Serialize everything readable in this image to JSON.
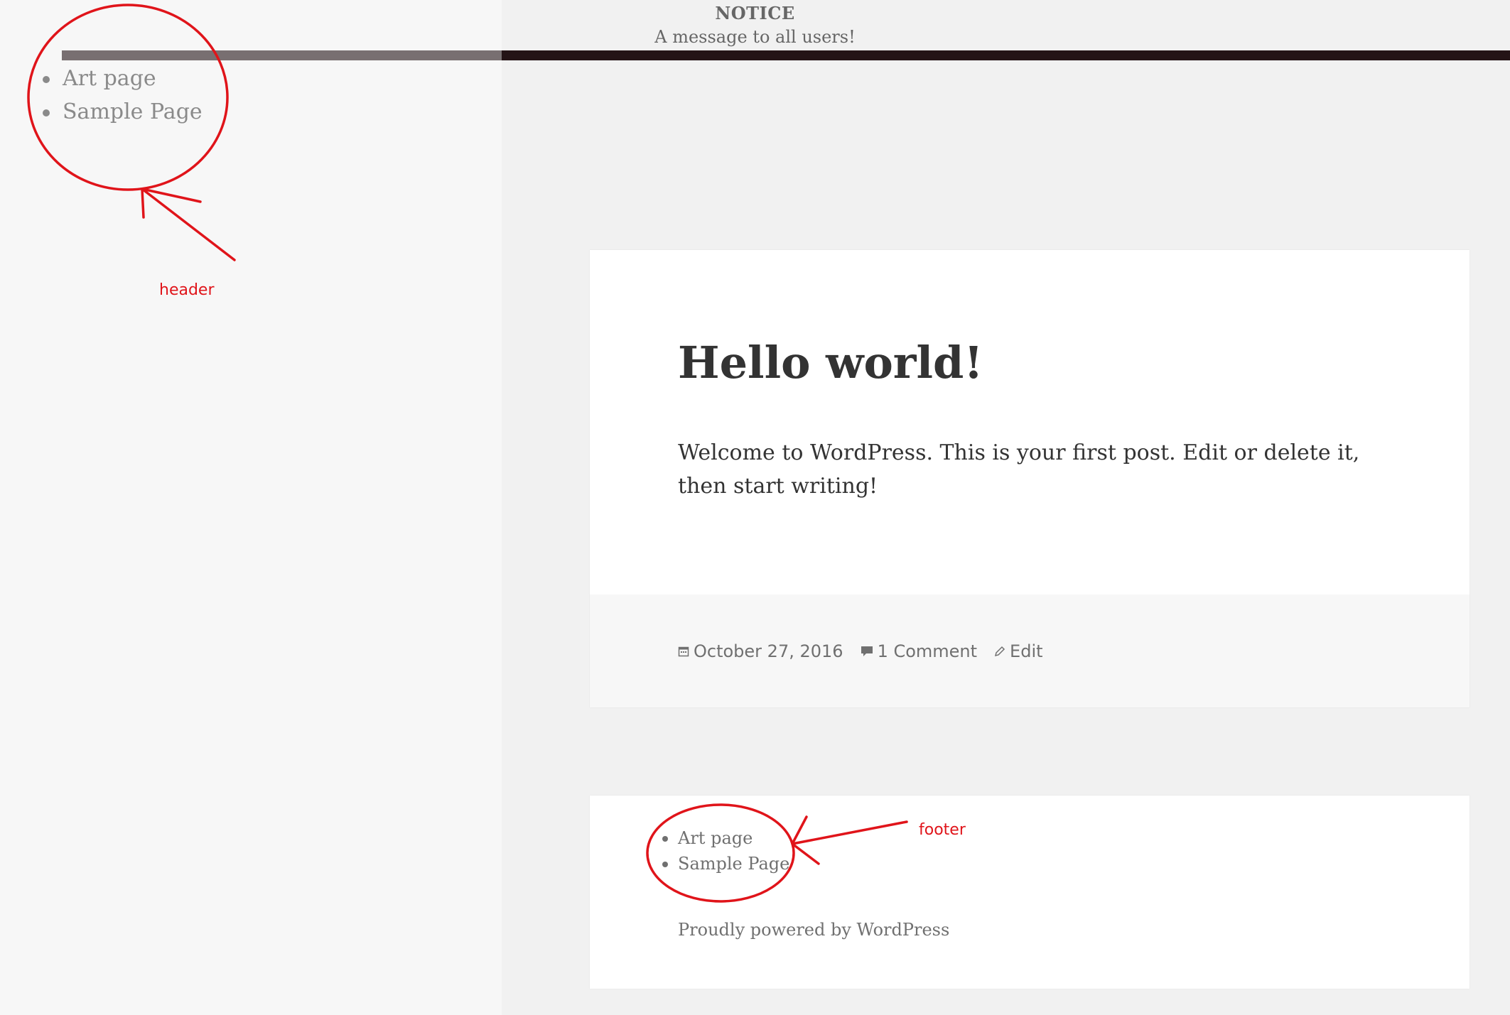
{
  "notice": {
    "title": "NOTICE",
    "message": "A message to all users!"
  },
  "header_menu": {
    "items": [
      {
        "label": "Art page"
      },
      {
        "label": "Sample Page"
      }
    ]
  },
  "post": {
    "title": "Hello world!",
    "content": "Welcome to WordPress. This is your first post. Edit or delete it, then start writing!",
    "meta": {
      "date": "October 27, 2016",
      "comments": "1 Comment",
      "edit": "Edit"
    }
  },
  "footer": {
    "menu_items": [
      {
        "label": "Art page"
      },
      {
        "label": "Sample Page"
      }
    ],
    "powered_by": "Proudly powered by WordPress"
  },
  "annotations": {
    "header_label": "header",
    "footer_label": "footer"
  },
  "colors": {
    "annotation": "#e0141a",
    "bar_light": "#786f71",
    "bar_dark": "#241316"
  }
}
